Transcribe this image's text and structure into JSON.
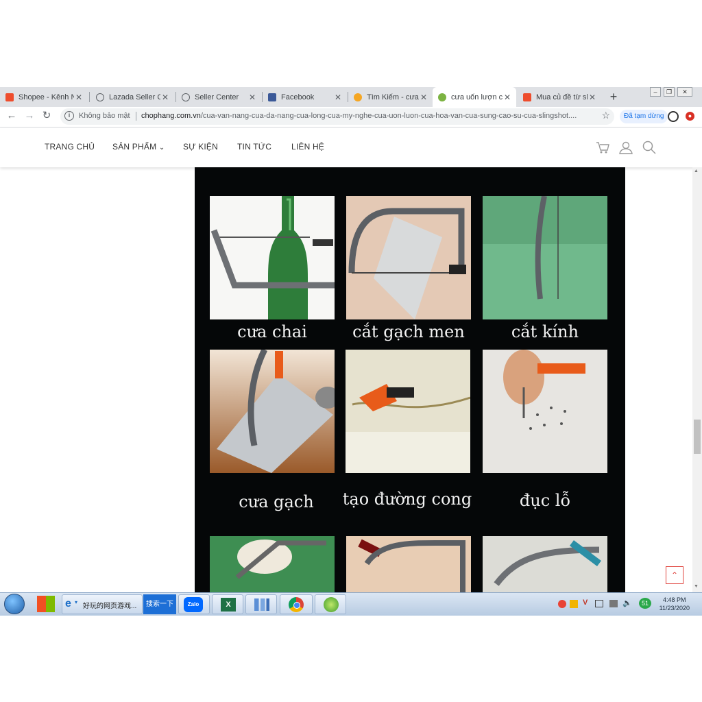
{
  "browser": {
    "tabs": [
      {
        "title": "Shopee - Kênh N",
        "favicon_color": "#ee4d2d",
        "active": false
      },
      {
        "title": "Lazada Seller Cen",
        "favicon_color": "#5f6368",
        "active": false
      },
      {
        "title": "Seller Center",
        "favicon_color": "#5f6368",
        "active": false
      },
      {
        "title": "Facebook",
        "favicon_color": "#3b5998",
        "active": false
      },
      {
        "title": "Tìm Kiếm - cưa v",
        "favicon_color": "#f5a623",
        "active": false
      },
      {
        "title": "cưa uốn lượn cưa",
        "favicon_color": "#7cb342",
        "active": true
      },
      {
        "title": "Mua củ đề từ sh",
        "favicon_color": "#ee4d2d",
        "active": false
      }
    ],
    "new_tab_label": "+",
    "security_label": "Không bảo mật",
    "url_domain": "chophang.com.vn",
    "url_path": "/cua-van-nang-cua-da-nang-cua-long-cua-my-nghe-cua-uon-luon-cua-hoa-van-cua-sung-cao-su-cua-slingshot....",
    "paused_label": "Đã tạm dừng"
  },
  "site": {
    "menu": [
      "TRANG CHỦ",
      "SẢN PHẨM",
      "SỰ KIỆN",
      "TIN TỨC",
      "LIÊN HỆ"
    ],
    "dropdown_caret": "⌄"
  },
  "product_image": {
    "captions": [
      "cưa chai",
      "cắt gạch men",
      "cắt kính",
      "cưa gạch",
      "tạo đường cong",
      "đục lỗ"
    ]
  },
  "taskbar": {
    "search_text": "好玩的网页游戏...",
    "search_button": "搜索一下",
    "tray_badge": "51",
    "time": "4:48 PM",
    "date": "11/23/2020"
  },
  "colors": {
    "accent_red": "#e0443e",
    "link_blue": "#1a73e8"
  }
}
